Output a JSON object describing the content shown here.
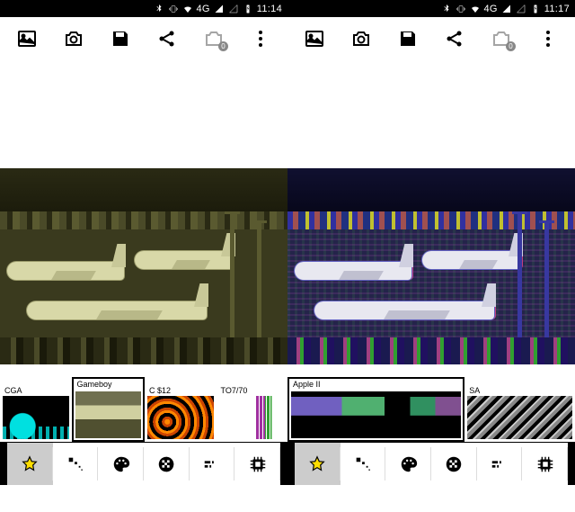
{
  "panes": [
    {
      "status": {
        "network": "4G",
        "time": "11:14"
      },
      "toolbar": {
        "layers_badge": "0"
      },
      "selected_filter": "Gameboy",
      "filters": [
        {
          "label": "CGA",
          "thumb": "th-cga"
        },
        {
          "label": "Gameboy",
          "thumb": "th-gameboy"
        },
        {
          "label": "C $12",
          "thumb": "th-c12"
        },
        {
          "label": "TO7/70",
          "thumb": "th-to7"
        }
      ]
    },
    {
      "status": {
        "network": "4G",
        "time": "11:17"
      },
      "toolbar": {
        "layers_badge": "0"
      },
      "selected_filter": "Apple II",
      "filters": [
        {
          "label": "Apple II",
          "thumb": "th-apple"
        },
        {
          "label": "SA",
          "thumb": "th-ga"
        }
      ]
    }
  ],
  "bottom_tools": [
    "favorites",
    "dither",
    "palette",
    "pattern",
    "levels",
    "processor"
  ],
  "colors": {
    "star": "#ffde00",
    "star_stroke": "#000"
  }
}
